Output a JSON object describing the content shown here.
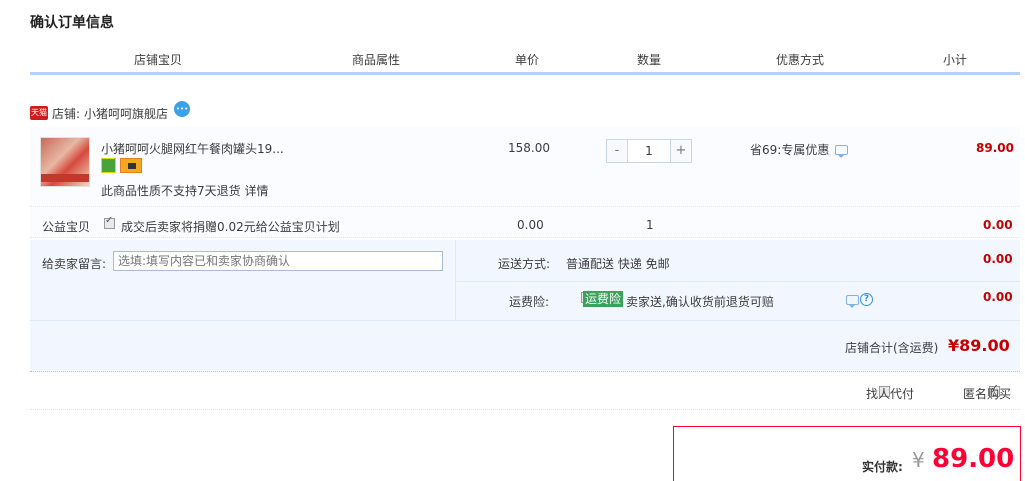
{
  "page_title": "确认订单信息",
  "columns": [
    "店铺宝贝",
    "商品属性",
    "单价",
    "数量",
    "优惠方式",
    "小计"
  ],
  "shop": {
    "badge": "天猫",
    "label": "店铺:",
    "name": "小猪呵呵旗舰店"
  },
  "item": {
    "title": "小猪呵呵火腿网红午餐肉罐头19...",
    "return_note": "此商品性质不支持7天退货 详情",
    "unit_price": "158.00",
    "quantity": "1",
    "qty_minus": "-",
    "qty_plus": "+",
    "promotion": "省69:专属优惠",
    "subtotal": "89.00"
  },
  "charity": {
    "label": "公益宝贝",
    "checked": true,
    "text": "成交后卖家将捐赠0.02元给公益宝贝计划",
    "price": "0.00",
    "quantity": "1",
    "subtotal": "0.00"
  },
  "message": {
    "label": "给卖家留言:",
    "placeholder": "选填:填写内容已和卖家协商确认"
  },
  "shipping": {
    "label": "运送方式:",
    "value": "普通配送 快递 免邮",
    "price": "0.00"
  },
  "insurance": {
    "label": "运费险:",
    "checked": true,
    "tag": "运费险",
    "text": "卖家送,确认收货前退货可赔",
    "price": "0.00"
  },
  "shop_total": {
    "label": "店铺合计(含运费)",
    "amount": "¥89.00"
  },
  "options": {
    "proxy_label": "找人代付",
    "proxy_checked": false,
    "anonymous_label": "匿名购买",
    "anonymous_checked": true
  },
  "payment": {
    "label": "实付款:",
    "currency": "¥",
    "amount": "89.00"
  },
  "colors": {
    "accent_red": "#ff0036",
    "price_red": "#c40000",
    "header_line": "#b2d1ff",
    "panel_bg": "#f2f7ff",
    "insurance_tag": "#3aa25a"
  }
}
